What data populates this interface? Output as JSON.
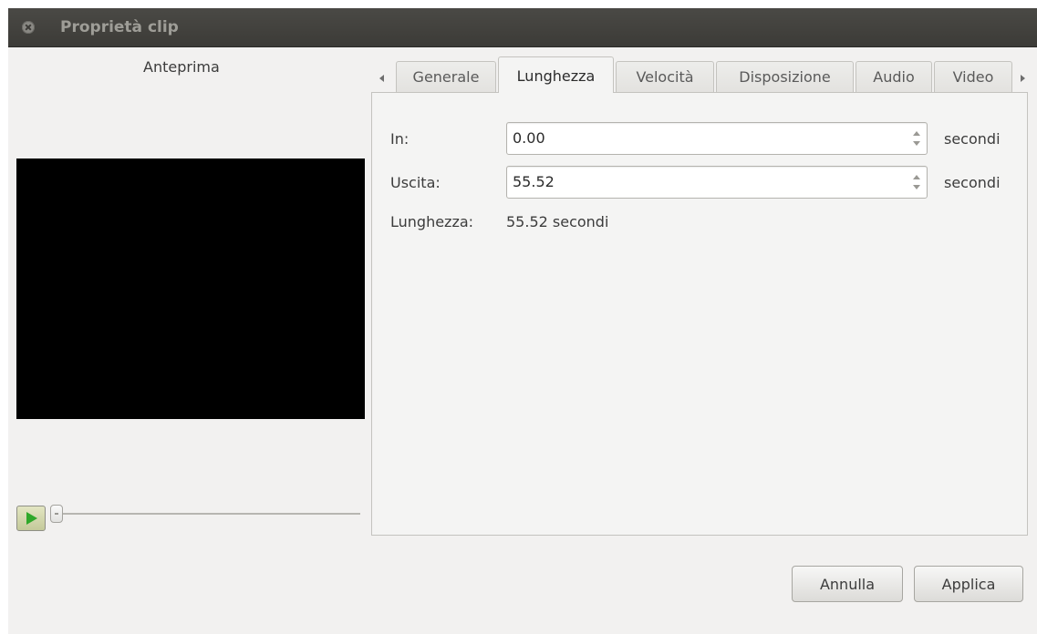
{
  "window": {
    "title": "Proprietà clip"
  },
  "preview": {
    "label": "Anteprima",
    "seek_fraction": 0.0
  },
  "tabs": [
    {
      "label": "Generale",
      "active": false
    },
    {
      "label": "Lunghezza",
      "active": true
    },
    {
      "label": "Velocità",
      "active": false
    },
    {
      "label": "Disposizione",
      "active": false
    },
    {
      "label": "Audio",
      "active": false
    },
    {
      "label": "Video",
      "active": false
    }
  ],
  "length_tab": {
    "in": {
      "label": "In:",
      "value": "0.00",
      "unit": "secondi"
    },
    "out": {
      "label": "Uscita:",
      "value": "55.52",
      "unit": "secondi"
    },
    "duration": {
      "label": "Lunghezza:",
      "value": "55.52 secondi"
    }
  },
  "buttons": {
    "cancel": "Annulla",
    "apply": "Applica"
  },
  "icons": {
    "close": "close-icon",
    "play": "play-icon",
    "tab_scroll_left": "chevron-left-icon",
    "tab_scroll_right": "chevron-right-icon",
    "spin_up": "chevron-up-icon",
    "spin_down": "chevron-down-icon"
  },
  "colors": {
    "titlebar": "#3c3b37",
    "window_bg": "#f2f1f0",
    "preview_bg": "#000000",
    "play_icon": "#2fa82a"
  }
}
